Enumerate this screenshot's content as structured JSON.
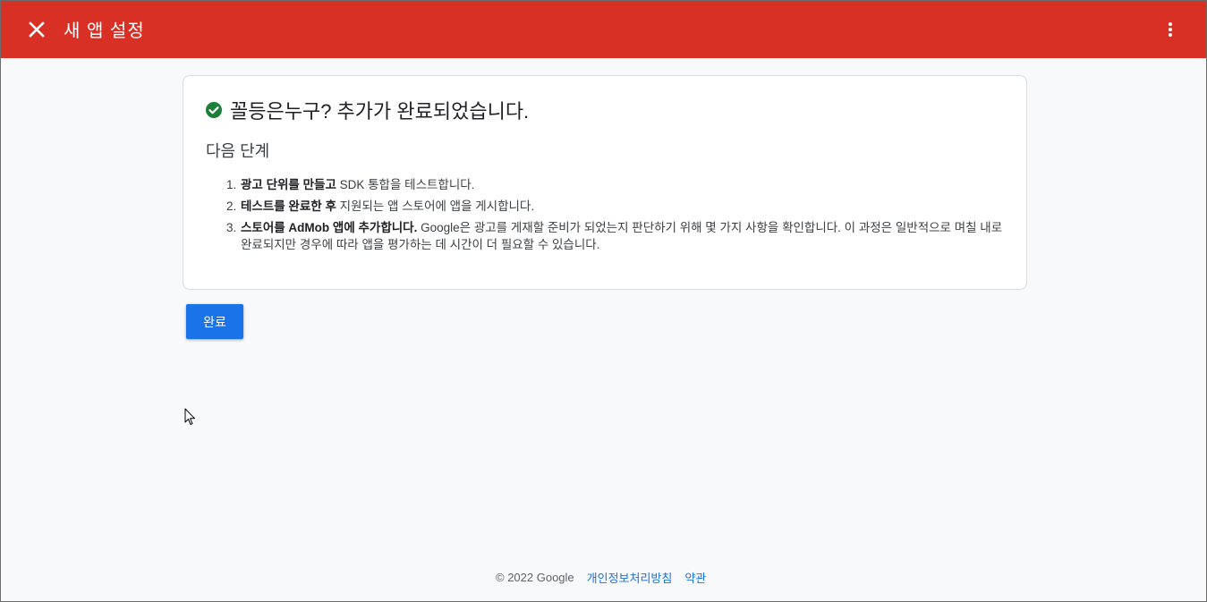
{
  "topbar": {
    "title": "새 앱 설정",
    "close_icon": "close-icon",
    "more_icon": "more-vert-icon",
    "background_color": "#d93025"
  },
  "card": {
    "status_icon": "check-circle-icon",
    "status_color": "#188038",
    "title": "꼴등은누구? 추가가 완료되었습니다.",
    "next_steps_heading": "다음 단계",
    "steps": [
      {
        "number": "1.",
        "strong": "광고 단위를 만들고",
        "text": " SDK 통합을 테스트합니다."
      },
      {
        "number": "2.",
        "strong": "테스트를 완료한 후",
        "text": " 지원되는 앱 스토어에 앱을 게시합니다."
      },
      {
        "number": "3.",
        "strong": "스토어를 AdMob 앱에 추가합니다.",
        "text": " Google은 광고를 게재할 준비가 되었는지 판단하기 위해 몇 가지 사항을 확인합니다. 이 과정은 일반적으로 며칠 내로 완료되지만 경우에 따라 앱을 평가하는 데 시간이 더 필요할 수 있습니다."
      }
    ]
  },
  "actions": {
    "done_label": "완료",
    "done_color": "#1a73e8"
  },
  "footer": {
    "copyright": "© 2022 Google",
    "privacy_link": "개인정보처리방침",
    "terms_link": "약관"
  }
}
